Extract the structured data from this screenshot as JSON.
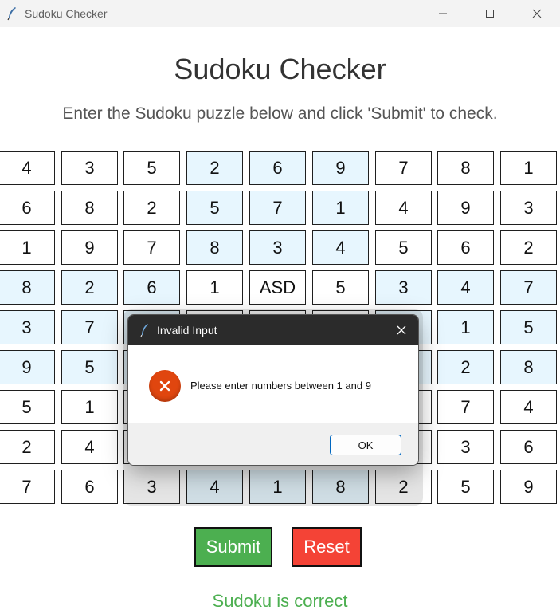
{
  "window": {
    "title": "Sudoku Checker"
  },
  "heading": "Sudoku Checker",
  "instructions": "Enter the Sudoku puzzle below and click 'Submit' to check.",
  "grid": [
    [
      "4",
      "3",
      "5",
      "2",
      "6",
      "9",
      "7",
      "8",
      "1"
    ],
    [
      "6",
      "8",
      "2",
      "5",
      "7",
      "1",
      "4",
      "9",
      "3"
    ],
    [
      "1",
      "9",
      "7",
      "8",
      "3",
      "4",
      "5",
      "6",
      "2"
    ],
    [
      "8",
      "2",
      "6",
      "1",
      "ASD",
      "5",
      "3",
      "4",
      "7"
    ],
    [
      "3",
      "7",
      "",
      "",
      "",
      "",
      "",
      "1",
      "5"
    ],
    [
      "9",
      "5",
      "",
      "",
      "",
      "",
      "",
      "2",
      "8"
    ],
    [
      "5",
      "1",
      "",
      "",
      "",
      "",
      "",
      "7",
      "4"
    ],
    [
      "2",
      "4",
      "",
      "",
      "",
      "",
      "",
      "3",
      "6"
    ],
    [
      "7",
      "6",
      "3",
      "4",
      "1",
      "8",
      "2",
      "5",
      "9"
    ]
  ],
  "buttons": {
    "submit": "Submit",
    "reset": "Reset"
  },
  "status": "Sudoku is correct",
  "dialog": {
    "title": "Invalid Input",
    "message": "Please enter numbers between 1 and 9",
    "ok_label": "OK"
  },
  "colors": {
    "highlight_cell": "#e7f6fe",
    "submit": "#4caf50",
    "reset": "#f44336",
    "status": "#4caf50",
    "error_icon": "#e0460f"
  }
}
